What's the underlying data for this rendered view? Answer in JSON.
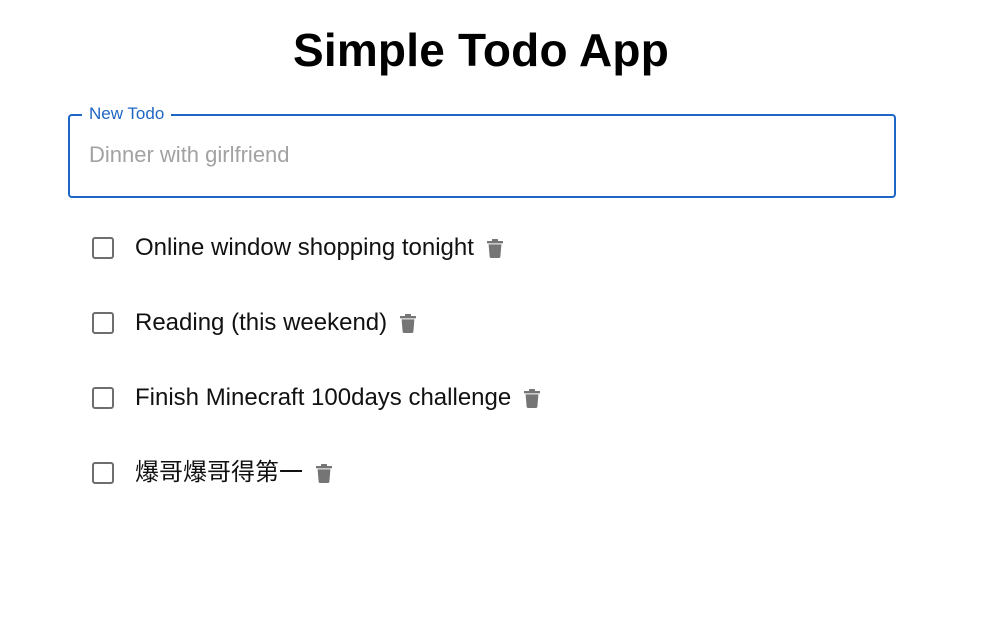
{
  "app": {
    "title": "Simple Todo App"
  },
  "new_todo": {
    "label": "New Todo",
    "value": "",
    "placeholder": "Dinner with girlfriend"
  },
  "todos": [
    {
      "text": "Online window shopping tonight",
      "completed": false,
      "delete_icon": "trash-icon"
    },
    {
      "text": "Reading (this weekend)",
      "completed": false,
      "delete_icon": "trash-icon"
    },
    {
      "text": "Finish Minecraft 100days challenge",
      "completed": false,
      "delete_icon": "trash-icon"
    },
    {
      "text": "爆哥爆哥得第一",
      "completed": false,
      "delete_icon": "trash-icon"
    }
  ],
  "colors": {
    "accent": "#1e66c4",
    "icon": "#757575",
    "checkbox_border": "#6e6e6e",
    "placeholder": "#a2a2a2"
  }
}
